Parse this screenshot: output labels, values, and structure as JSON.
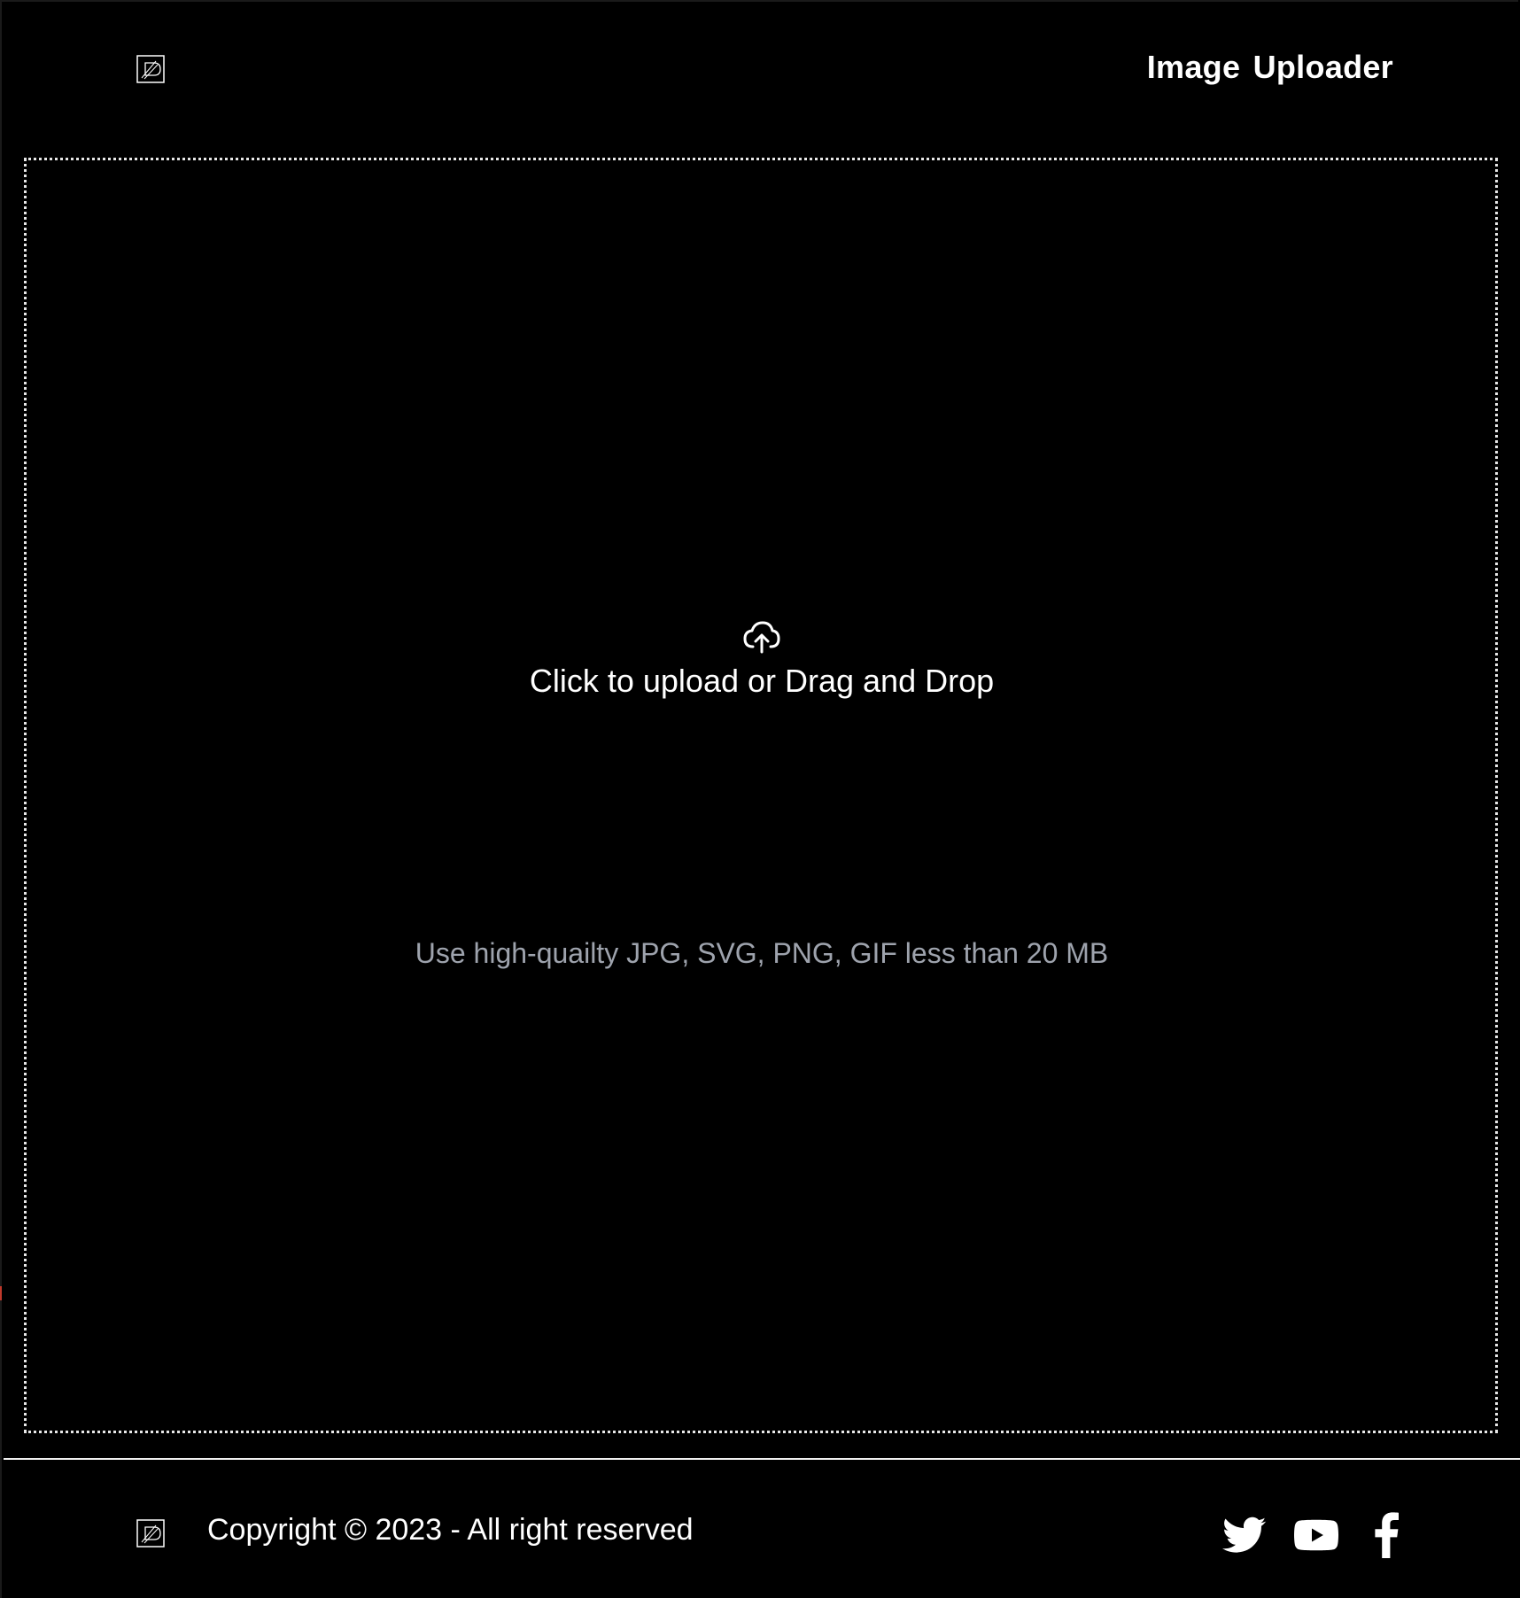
{
  "header": {
    "logo_icon": "logo-d-icon",
    "title": "Image Uploader"
  },
  "upload": {
    "icon": "cloud-upload-icon",
    "label": "Click to upload or Drag and Drop",
    "hint": "Use high-quailty JPG, SVG, PNG, GIF less than 20 MB"
  },
  "footer": {
    "logo_icon": "logo-d-icon",
    "copyright": "Copyright © 2023 - All right reserved",
    "social": [
      {
        "name": "twitter-icon"
      },
      {
        "name": "youtube-icon"
      },
      {
        "name": "facebook-icon"
      }
    ]
  },
  "colors": {
    "background": "#000000",
    "text": "#ffffff",
    "hint": "#9ea3ad",
    "border": "#e8e8e8"
  }
}
